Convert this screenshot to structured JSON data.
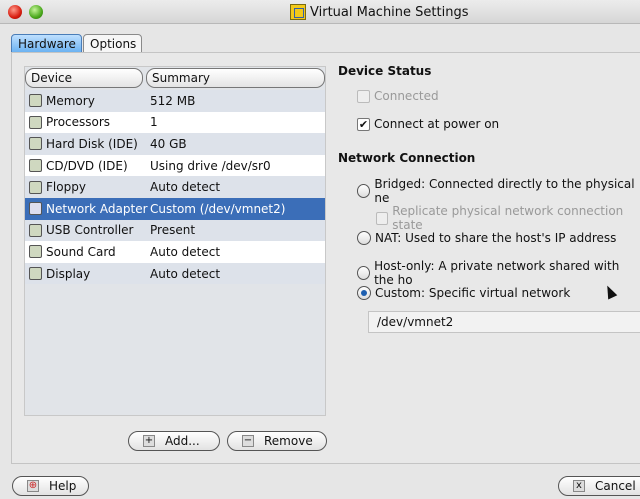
{
  "window": {
    "title": "Virtual Machine Settings"
  },
  "tabs": [
    {
      "label": "Hardware",
      "active": true
    },
    {
      "label": "Options",
      "active": false
    }
  ],
  "device_list": {
    "headers": [
      "Device",
      "Summary"
    ],
    "rows": [
      {
        "device": "Memory",
        "summary": "512 MB",
        "icon": "memory-icon"
      },
      {
        "device": "Processors",
        "summary": "1",
        "icon": "processor-icon"
      },
      {
        "device": "Hard Disk (IDE)",
        "summary": "40 GB",
        "icon": "hard-disk-icon"
      },
      {
        "device": "CD/DVD (IDE)",
        "summary": "Using drive /dev/sr0",
        "icon": "cd-icon"
      },
      {
        "device": "Floppy",
        "summary": "Auto detect",
        "icon": "floppy-icon"
      },
      {
        "device": "Network Adapter",
        "summary": "Custom (/dev/vmnet2)",
        "icon": "network-icon",
        "selected": true
      },
      {
        "device": "USB Controller",
        "summary": "Present",
        "icon": "usb-icon"
      },
      {
        "device": "Sound Card",
        "summary": "Auto detect",
        "icon": "sound-icon"
      },
      {
        "device": "Display",
        "summary": "Auto detect",
        "icon": "display-icon"
      }
    ]
  },
  "buttons": {
    "add": "Add...",
    "remove": "Remove",
    "help": "Help",
    "cancel": "Cancel"
  },
  "device_status": {
    "title": "Device Status",
    "connected": "Connected",
    "connect_power_on": "Connect at power on"
  },
  "network": {
    "title": "Network Connection",
    "bridged": "Bridged: Connected directly to the physical ne",
    "replicate": "Replicate physical network connection state",
    "nat": "NAT: Used to share the host's IP address",
    "hostonly": "Host-only: A private network shared with the ho",
    "custom": "Custom: Specific virtual network",
    "custom_value": "/dev/vmnet2"
  }
}
